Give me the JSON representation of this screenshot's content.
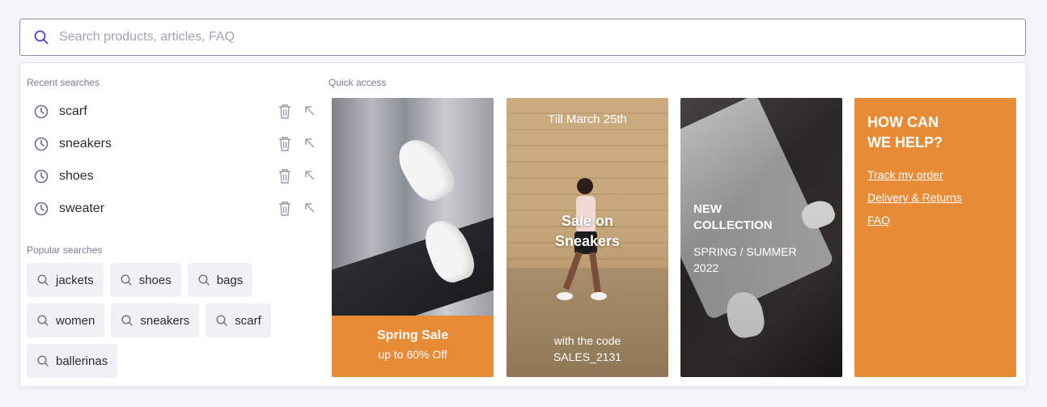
{
  "search": {
    "placeholder": "Search products, articles, FAQ",
    "icon": "search-icon"
  },
  "recent": {
    "title": "Recent searches",
    "items": [
      {
        "label": "scarf"
      },
      {
        "label": "sneakers"
      },
      {
        "label": "shoes"
      },
      {
        "label": "sweater"
      }
    ]
  },
  "popular": {
    "title": "Popular searches",
    "rows": [
      [
        "jackets",
        "shoes",
        "bags"
      ],
      [
        "women",
        "sneakers",
        "scarf"
      ],
      [
        "ballerinas"
      ]
    ]
  },
  "quick": {
    "title": "Quick access",
    "cards": [
      {
        "title": "Spring Sale",
        "subtitle": "up to 60% Off"
      },
      {
        "top": "Till March 25th",
        "title": "Sale on Sneakers",
        "line1": "with the code",
        "line2": "SALES_2131"
      },
      {
        "title_line1": "NEW",
        "title_line2": "COLLECTION",
        "sub_line1": "SPRING / SUMMER",
        "sub_line2": "2022"
      },
      {
        "title_line1": "HOW CAN",
        "title_line2": "WE HELP?",
        "links": [
          "Track my order",
          "Delivery & Returns",
          "FAQ"
        ]
      }
    ]
  },
  "colors": {
    "accent": "#e88b36",
    "icon": "#5a4fcf",
    "muted_icon": "#8a8aa0"
  }
}
